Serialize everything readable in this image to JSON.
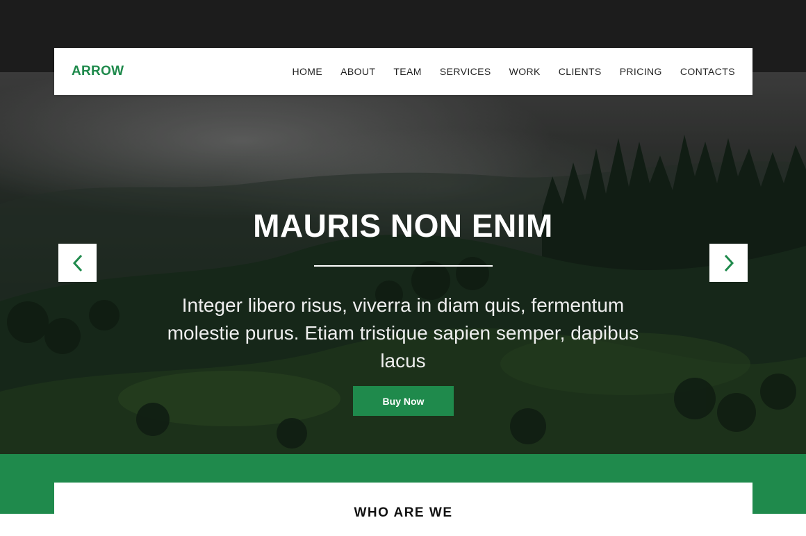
{
  "navbar": {
    "logo": "ARROW",
    "items": [
      "HOME",
      "ABOUT",
      "TEAM",
      "SERVICES",
      "WORK",
      "CLIENTS",
      "PRICING",
      "CONTACTS"
    ]
  },
  "hero": {
    "title": "MAURIS NON ENIM",
    "text": "Integer libero risus, viverra in diam quis, fermentum molestie purus. Etiam tristique sapien semper, dapibus lacus",
    "button_label": "Buy Now",
    "prev_icon": "chevron-left-icon",
    "next_icon": "chevron-right-icon"
  },
  "about": {
    "title": "WHO ARE WE"
  },
  "colors": {
    "accent": "#1f8a4c",
    "dark_band": "#1c1c1c",
    "white": "#ffffff"
  }
}
